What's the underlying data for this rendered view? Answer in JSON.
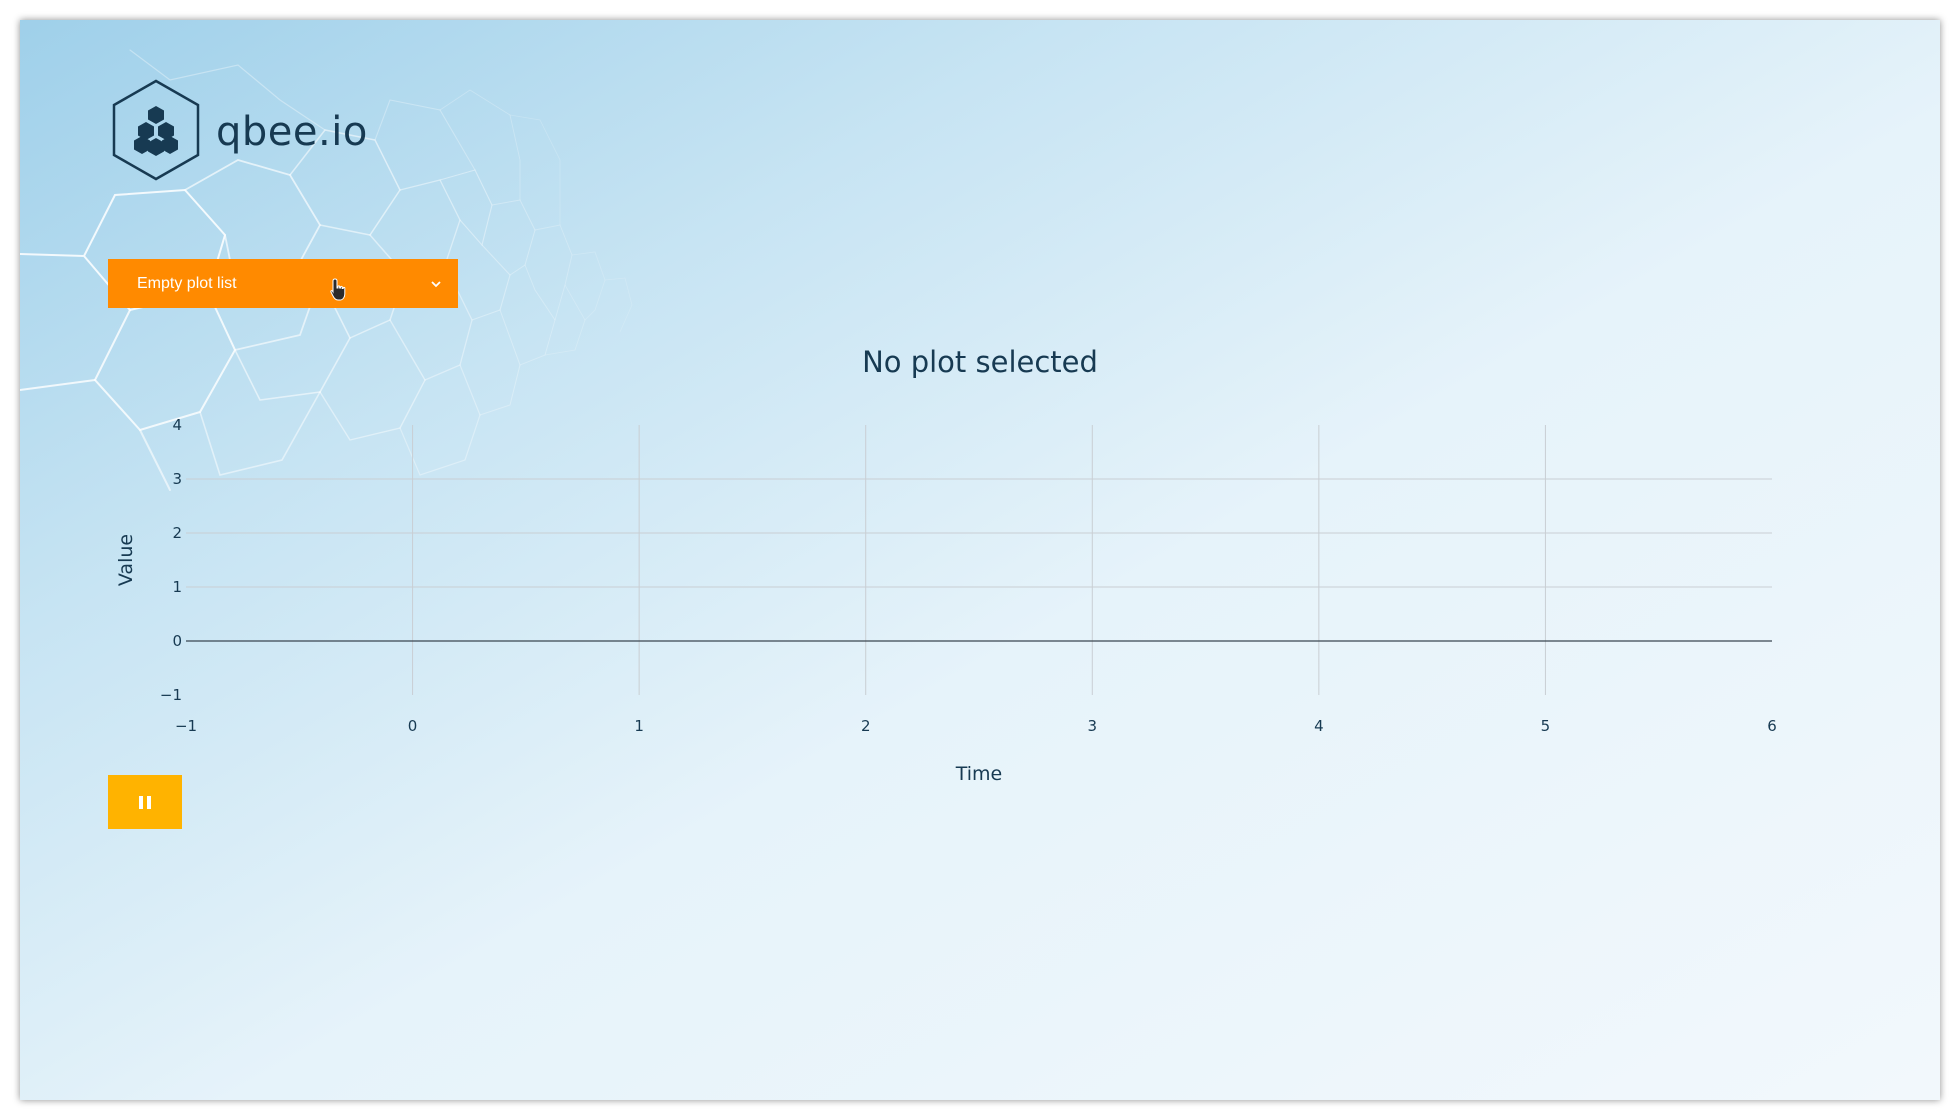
{
  "app": {
    "logo_text": "qbee.io",
    "logo_icon": "qbee-hexagon-logo-icon"
  },
  "plot_selector": {
    "label": "Empty plot list",
    "icon": "chevron-down-icon"
  },
  "plot": {
    "title": "No plot selected"
  },
  "controls": {
    "pause_icon": "pause-icon"
  },
  "colors": {
    "dropdown": "#ff8a00",
    "pause_button": "#ffb300",
    "text_dark": "#173a52"
  },
  "chart_data": {
    "type": "line",
    "title": "No plot selected",
    "xlabel": "Time",
    "ylabel": "Value",
    "xlim": [
      -1,
      6
    ],
    "ylim": [
      -1,
      4
    ],
    "x_ticks": [
      "−1",
      "0",
      "1",
      "2",
      "3",
      "4",
      "5",
      "6"
    ],
    "y_ticks": [
      "−1",
      "0",
      "1",
      "2",
      "3",
      "4"
    ],
    "series": [],
    "grid": true
  }
}
